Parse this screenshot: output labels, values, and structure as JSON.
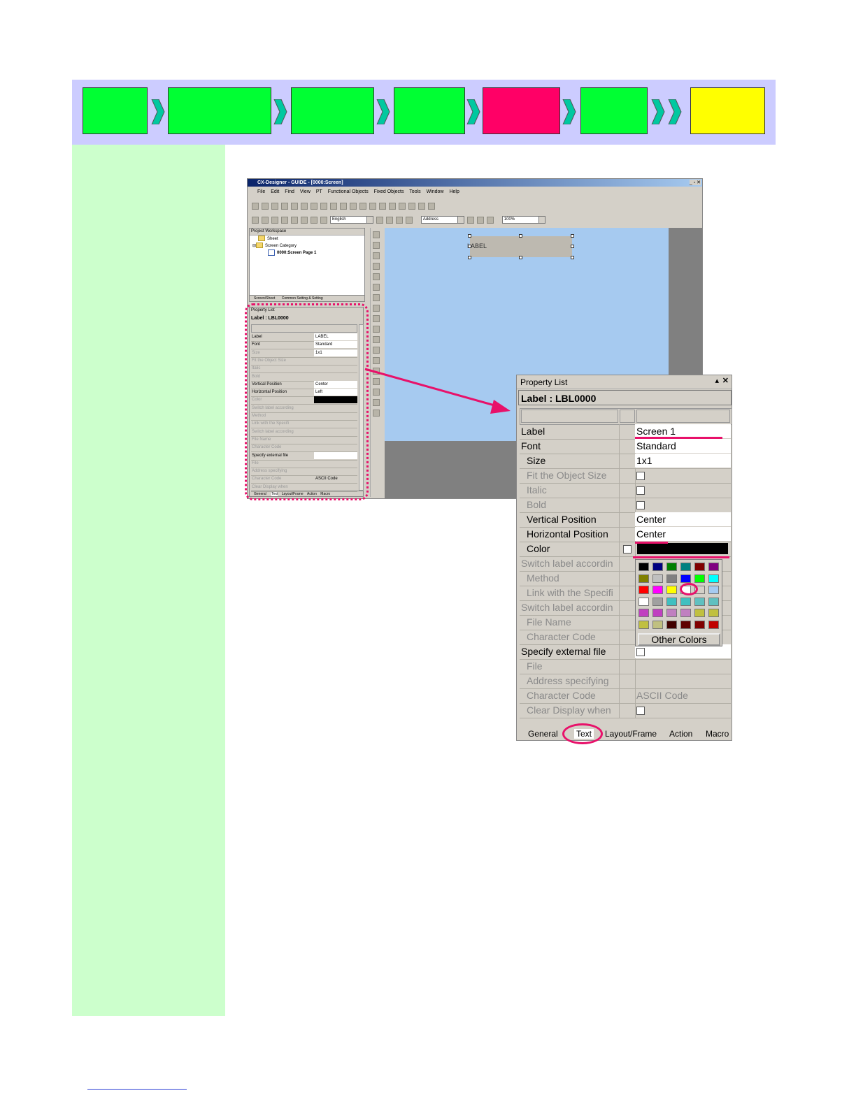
{
  "colors": {
    "step_green": "#00ff33",
    "step_red": "#ff0066",
    "step_yellow": "#ffff00",
    "stepbar_bg": "#ccccff",
    "left_strip_bg": "#ccffcc",
    "highlight_pink": "#e8116a"
  },
  "app": {
    "title": "CX-Designer - GUIDE - [0000:Screen]",
    "menu": [
      "File",
      "Edit",
      "Find",
      "View",
      "PT",
      "Functional Objects",
      "Fixed Objects",
      "Tools",
      "Window",
      "Help"
    ],
    "language_combo": "English",
    "address_combo": "Address",
    "zoom_combo": "100%",
    "workspace": {
      "title": "Project Workspace",
      "items": [
        "Sheet",
        "Screen Category",
        "0000:Screen Page 1"
      ],
      "tabs": [
        "Screen/Sheet",
        "Common Setting & Setting"
      ]
    },
    "small_property_list": {
      "title": "Property List",
      "object": "Label : LBL0000",
      "rows": [
        {
          "k": "Label",
          "v": "LABEL"
        },
        {
          "k": "Font",
          "v": "Standard"
        },
        {
          "k": "Size",
          "v": "1x1"
        },
        {
          "k": "Fit the Object Size",
          "v": ""
        },
        {
          "k": "Italic",
          "v": ""
        },
        {
          "k": "Bold",
          "v": ""
        },
        {
          "k": "Vertical Position",
          "v": "Center"
        },
        {
          "k": "Horizontal Position",
          "v": "Left"
        },
        {
          "k": "Color",
          "v": ""
        },
        {
          "k": "Switch label according",
          "v": ""
        },
        {
          "k": "Method",
          "v": ""
        },
        {
          "k": "Link with the Specifi",
          "v": ""
        },
        {
          "k": "Switch label according",
          "v": ""
        },
        {
          "k": "File Name",
          "v": ""
        },
        {
          "k": "Character Code",
          "v": ""
        },
        {
          "k": "Specify external file",
          "v": ""
        },
        {
          "k": "File",
          "v": ""
        },
        {
          "k": "Address specifying",
          "v": ""
        },
        {
          "k": "Character Code",
          "v": "ASCII Code"
        },
        {
          "k": "Clear Display when",
          "v": ""
        }
      ],
      "tabs": [
        "General",
        "Text",
        "Layout/Frame",
        "Action",
        "Macro"
      ]
    },
    "canvas_label": "LABEL"
  },
  "property_list": {
    "title": "Property List",
    "object": "Label : LBL0000",
    "rows": {
      "label": {
        "k": "Label",
        "v": "Screen 1"
      },
      "font": {
        "k": "Font",
        "v": "Standard"
      },
      "size": {
        "k": "Size",
        "v": "1x1"
      },
      "fit": {
        "k": "Fit the Object Size"
      },
      "italic": {
        "k": "Italic"
      },
      "bold": {
        "k": "Bold"
      },
      "vpos": {
        "k": "Vertical Position",
        "v": "Center"
      },
      "hpos": {
        "k": "Horizontal Position",
        "v": "Center"
      },
      "color": {
        "k": "Color"
      },
      "switch1": {
        "k": "Switch label accordin"
      },
      "method": {
        "k": "Method"
      },
      "link": {
        "k": "Link with the Specifi"
      },
      "switch2": {
        "k": "Switch label accordin"
      },
      "filename": {
        "k": "File Name"
      },
      "charcode1": {
        "k": "Character Code"
      },
      "specify": {
        "k": "Specify external file"
      },
      "file": {
        "k": "File"
      },
      "address": {
        "k": "Address specifying"
      },
      "charcode2": {
        "k": "Character Code",
        "v": "ASCII Code"
      },
      "clear": {
        "k": "Clear Display when"
      }
    },
    "palette_other": "Other Colors",
    "palette_swatches": [
      "#000000",
      "#000080",
      "#008000",
      "#008080",
      "#800000",
      "#800080",
      "#808000",
      "#c0c0c0",
      "#808080",
      "#0000ff",
      "#00ff00",
      "#00ffff",
      "#ff0000",
      "#ff00ff",
      "#ffff00",
      "#ffffff",
      "#d4d0c8",
      "#a6caf0",
      "#ffffff",
      "#a0a0a0",
      "#40c0c0",
      "#40c0c0",
      "#60c0c0",
      "#60c0c0",
      "#c040c0",
      "#c040c0",
      "#c080c0",
      "#c080c0",
      "#c0c040",
      "#c0c040",
      "#c0c040",
      "#c0c080",
      "#400000",
      "#600000",
      "#800000",
      "#c00000"
    ],
    "tabs": [
      "General",
      "Text",
      "Layout/Frame",
      "Action",
      "Macro"
    ]
  }
}
